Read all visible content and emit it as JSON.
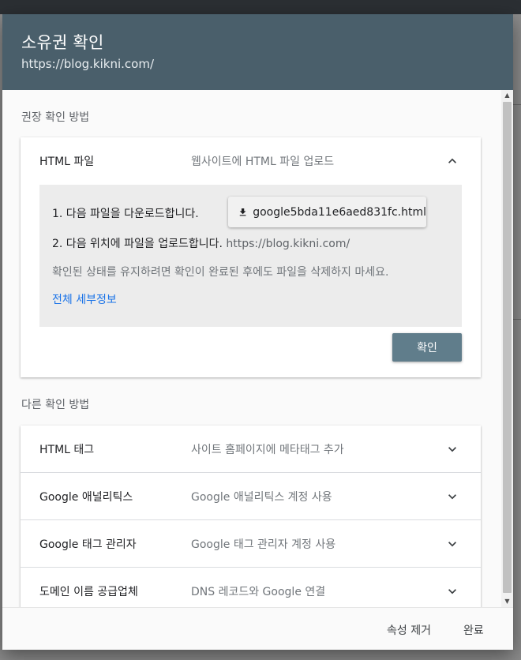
{
  "dialog": {
    "title": "소유권 확인",
    "subtitle": "https://blog.kikni.com/"
  },
  "recommended": {
    "section_label": "권장 확인 방법",
    "method": {
      "name": "HTML 파일",
      "description": "웹사이트에 HTML 파일 업로드",
      "step1_text": "1. 다음 파일을 다운로드합니다.",
      "download_file": "google5bda11e6aed831fc.html",
      "step2_text": "2. 다음 위치에 파일을 업로드합니다.",
      "step2_url": "https://blog.kikni.com/",
      "note": "확인된 상태를 유지하려면 확인이 완료된 후에도 파일을 삭제하지 마세요.",
      "details_link": "전체 세부정보",
      "verify_label": "확인"
    }
  },
  "other": {
    "section_label": "다른 확인 방법",
    "methods": [
      {
        "name": "HTML 태그",
        "description": "사이트 홈페이지에 메타태그 추가"
      },
      {
        "name": "Google 애널리틱스",
        "description": "Google 애널리틱스 계정 사용"
      },
      {
        "name": "Google 태그 관리자",
        "description": "Google 태그 관리자 계정 사용"
      },
      {
        "name": "도메인 이름 공급업체",
        "description": "DNS 레코드와 Google 연결"
      }
    ]
  },
  "footer": {
    "remove_label": "속성 제거",
    "done_label": "완료"
  },
  "colors": {
    "header": "#4a5f6b",
    "verify_button": "#607d8b",
    "link": "#1a73e8"
  },
  "icons": {
    "expand": "chevron-up-icon",
    "collapse": "chevron-down-icon",
    "download": "download-icon"
  }
}
